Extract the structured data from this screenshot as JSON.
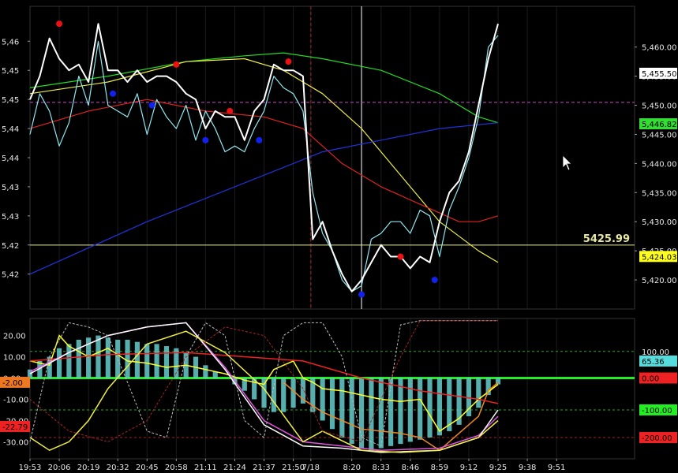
{
  "chart_data": [
    {
      "type": "line",
      "panel": "price",
      "y_axis_left": {
        "range": [
          5415,
          5467
        ],
        "ticks": [
          "5,46",
          "5,45",
          "5,45",
          "5,44",
          "5,44",
          "5,43",
          "5,43",
          "5,42",
          "5,42"
        ],
        "tick_values": [
          5461,
          5456,
          5451,
          5446,
          5441,
          5436,
          5431,
          5426,
          5421
        ]
      },
      "y_axis_right": {
        "range": [
          5415,
          5467
        ],
        "ticks": [
          "5,460.00",
          "5,455.00",
          "5,450.00",
          "5,445.00",
          "5,440.00",
          "5,435.00",
          "5,430.00",
          "5,425.00",
          "5,420.00"
        ],
        "tick_values": [
          5460,
          5455,
          5450,
          5445,
          5440,
          5435,
          5430,
          5425,
          5420
        ]
      },
      "x_axis": {
        "range": [
          0,
          62
        ],
        "ticks": [
          "19:53",
          "20:06",
          "20:19",
          "20:32",
          "20:45",
          "20:58",
          "21:11",
          "21:24",
          "21:37",
          "21:50",
          "7/18",
          "8:20",
          "8:33",
          "8:46",
          "8:59",
          "9:12",
          "9:25",
          "9:38",
          "9:51"
        ],
        "tick_positions": [
          0,
          3,
          6,
          9,
          12,
          15,
          18,
          21,
          24,
          27,
          28.8,
          33,
          36,
          39,
          42,
          45,
          48,
          51,
          54
        ]
      },
      "series": [
        {
          "color": "#ffffff",
          "x": [
            0,
            1,
            2,
            3,
            4,
            5,
            6,
            7,
            8,
            9,
            10,
            11,
            12,
            13,
            14,
            15,
            16,
            17,
            18,
            19,
            20,
            21,
            22,
            23,
            24,
            25,
            26,
            27,
            28,
            29,
            30,
            31,
            32,
            33,
            34,
            35,
            36,
            37,
            38,
            39,
            40,
            41,
            42,
            43,
            44,
            45,
            46,
            47,
            48
          ],
          "values": [
            5451,
            5455,
            5461.5,
            5458,
            5456,
            5457,
            5454,
            5464,
            5456,
            5456,
            5454,
            5456,
            5454,
            5455,
            5455,
            5454,
            5452,
            5451,
            5446,
            5449,
            5448,
            5448,
            5444,
            5449,
            5451,
            5457,
            5456,
            5456,
            5455,
            5427,
            5430,
            5425,
            5421,
            5418,
            5420,
            5423,
            5426,
            5424,
            5424,
            5422,
            5424,
            5423,
            5430,
            5435,
            5437,
            5442,
            5450,
            5458,
            5464
          ]
        },
        {
          "color": "#8fe8f0",
          "x": [
            0,
            1,
            2,
            3,
            4,
            5,
            6,
            7,
            8,
            9,
            10,
            11,
            12,
            13,
            14,
            15,
            16,
            17,
            18,
            19,
            20,
            21,
            22,
            23,
            24,
            25,
            26,
            27,
            28,
            29,
            30,
            31,
            32,
            33,
            34,
            35,
            36,
            37,
            38,
            39,
            40,
            41,
            42,
            43,
            44,
            45,
            46,
            47,
            48
          ],
          "values": [
            5445,
            5452,
            5449,
            5443,
            5447,
            5455,
            5450,
            5461,
            5450,
            5449,
            5448,
            5452,
            5445,
            5451,
            5448,
            5446,
            5450,
            5444,
            5449,
            5446,
            5442,
            5443,
            5442,
            5446,
            5449,
            5455,
            5453,
            5452,
            5449,
            5435,
            5428,
            5425,
            5420,
            5418,
            5419,
            5427,
            5428,
            5430,
            5430,
            5428,
            5432,
            5431,
            5424,
            5432,
            5436,
            5441,
            5448,
            5460,
            5462
          ]
        },
        {
          "color": "#22dd22",
          "x": [
            0,
            8,
            16,
            22,
            26,
            30,
            36,
            42,
            46,
            48
          ],
          "values": [
            5453,
            5455,
            5457.5,
            5458.5,
            5459,
            5458,
            5456,
            5452,
            5448,
            5447
          ]
        },
        {
          "color": "#eeee44",
          "x": [
            0,
            8,
            16,
            22,
            26,
            30,
            34,
            38,
            42,
            46,
            48
          ],
          "values": [
            5452,
            5454,
            5457.5,
            5458,
            5456,
            5452,
            5446,
            5438,
            5430,
            5425,
            5423
          ]
        },
        {
          "color": "#dd2222",
          "x": [
            0,
            6,
            12,
            18,
            24,
            28,
            32,
            36,
            40,
            44,
            46,
            48
          ],
          "values": [
            5446,
            5449,
            5451,
            5449,
            5448,
            5446,
            5440,
            5436,
            5433,
            5430,
            5430,
            5431
          ]
        },
        {
          "color": "#2233dd",
          "x": [
            0,
            12,
            24,
            30,
            36,
            42,
            48
          ],
          "values": [
            5421,
            5430,
            5438,
            5442,
            5444,
            5446,
            5447
          ]
        }
      ],
      "markers_red": [
        [
          3,
          5464
        ],
        [
          15,
          5457
        ],
        [
          20.5,
          5449
        ],
        [
          26.5,
          5457.5
        ],
        [
          38,
          5424
        ]
      ],
      "markers_blue": [
        [
          8.5,
          5452
        ],
        [
          12.5,
          5450
        ],
        [
          18,
          5444
        ],
        [
          23.5,
          5444
        ],
        [
          34,
          5417.5
        ],
        [
          41.5,
          5420
        ]
      ],
      "reference_lines": [
        {
          "value": 5425.99,
          "label": "5425.99",
          "color": "#e8e8a0"
        },
        {
          "value": 5450.5,
          "color": "#cc44cc",
          "dashed": true
        }
      ],
      "vertical_lines": [
        {
          "x": 28.8,
          "color": "#aa2222",
          "dashed": true
        },
        {
          "x": 34,
          "color": "#ffffff"
        }
      ],
      "right_tags": [
        {
          "value": 5455.5,
          "label": "5,455.50",
          "bg": "#ffffff",
          "fg": "#000000"
        },
        {
          "value": 5446.82,
          "label": "5,446.82",
          "bg": "#33dd33",
          "fg": "#000000"
        },
        {
          "value": 5424.03,
          "label": "5,424.03",
          "bg": "#ffff22",
          "fg": "#000000"
        }
      ]
    },
    {
      "type": "bar",
      "panel": "oscillator",
      "y_axis_left": {
        "range": [
          -38,
          28
        ],
        "ticks": [
          "20.00",
          "10.00",
          "0.00",
          "-10.00",
          "-20.00",
          "-30.00"
        ],
        "tick_values": [
          20,
          10,
          0,
          -10,
          -20,
          -30
        ]
      },
      "y_axis_right": {
        "ticks": [
          "100.00",
          "0.00",
          "-100.00",
          "-200.00"
        ],
        "tick_values": [
          12.5,
          0,
          -15,
          -28
        ]
      },
      "bars": {
        "color": "#66cccc",
        "x": [
          0,
          1,
          2,
          3,
          4,
          5,
          6,
          7,
          8,
          9,
          10,
          11,
          12,
          13,
          14,
          15,
          16,
          17,
          18,
          19,
          20,
          21,
          22,
          23,
          24,
          25,
          26,
          27,
          28,
          29,
          30,
          31,
          32,
          33,
          34,
          35,
          36,
          37,
          38,
          39,
          40,
          41,
          42,
          43,
          44,
          45,
          46,
          47,
          48
        ],
        "values": [
          4,
          8,
          10,
          14,
          16,
          18,
          19,
          20,
          19,
          18,
          18,
          17,
          16,
          16,
          15,
          14,
          12,
          10,
          6,
          3,
          0,
          -3,
          -6,
          -10,
          -14,
          -16,
          -16,
          -14,
          -12,
          -16,
          -20,
          -24,
          -28,
          -31,
          -33,
          -34,
          -33,
          -32,
          -31,
          -30,
          -29,
          -28,
          -27,
          -25,
          -22,
          -18,
          -14,
          -8,
          -3
        ]
      },
      "series": [
        {
          "color": "#ffff22",
          "x": [
            0,
            2,
            3,
            4,
            6,
            8,
            10,
            12,
            14,
            16,
            18,
            20,
            22,
            24,
            25,
            26,
            27,
            28,
            29,
            30,
            32,
            34,
            36,
            38,
            40,
            42,
            44,
            46,
            48
          ],
          "values": [
            8,
            6,
            20,
            15,
            10,
            14,
            8,
            7,
            5,
            6,
            4,
            2,
            -1,
            -3,
            4,
            6,
            8,
            0,
            -2,
            -5,
            -6,
            -8,
            -10,
            -11,
            -10,
            -25,
            -19,
            -10,
            -3
          ]
        },
        {
          "color": "#ee8822",
          "x": [
            26,
            28,
            30,
            32,
            34,
            36,
            38,
            40,
            42,
            44,
            46,
            47,
            48
          ],
          "values": [
            -2,
            -10,
            -16,
            -20,
            -24,
            -25,
            -26,
            -28,
            -34,
            -26,
            -18,
            -6,
            -2
          ]
        },
        {
          "color": "#ee2222",
          "x": [
            0,
            8,
            16,
            22,
            28,
            34,
            40,
            46,
            48
          ],
          "values": [
            8,
            11,
            12,
            10,
            8,
            0,
            -6,
            -10,
            -12
          ]
        },
        {
          "color": "#dd55dd",
          "x": [
            0,
            4,
            8,
            12,
            16,
            20,
            24,
            28,
            32,
            36,
            42,
            46,
            48
          ],
          "values": [
            3,
            12,
            20,
            24,
            26,
            5,
            -20,
            -30,
            -32,
            -34,
            -33,
            -27,
            -18
          ]
        },
        {
          "color": "#ffffff",
          "x": [
            0,
            4,
            8,
            12,
            16,
            20,
            24,
            28,
            32,
            36,
            42,
            46,
            48
          ],
          "values": [
            2,
            12,
            20,
            24,
            26,
            4,
            -22,
            -32,
            -33,
            -35,
            -34,
            -28,
            -15
          ]
        },
        {
          "color": "#eeee44",
          "x": [
            0,
            2,
            4,
            6,
            8,
            12,
            16,
            20,
            24,
            28,
            30,
            34,
            38,
            42,
            46,
            48
          ],
          "values": [
            -28,
            -34,
            -30,
            -20,
            -5,
            16,
            22,
            12,
            -5,
            -30,
            -25,
            -34,
            -35,
            -34,
            -28,
            -20
          ]
        },
        {
          "color": "#bbbbbb",
          "dashed": true,
          "x": [
            0,
            2,
            4,
            6,
            8,
            10,
            12,
            14,
            16,
            18,
            20,
            22,
            24,
            26,
            28,
            30,
            32,
            34,
            36,
            38,
            40,
            42,
            44,
            46,
            48
          ],
          "values": [
            -30,
            10,
            26,
            24,
            20,
            -2,
            -25,
            -28,
            10,
            26,
            20,
            -20,
            -28,
            20,
            26,
            26,
            10,
            -28,
            -32,
            25,
            27,
            27,
            27,
            27,
            27
          ]
        },
        {
          "color": "#aa2222",
          "dashed": true,
          "x": [
            0,
            4,
            8,
            12,
            16,
            20,
            24,
            28,
            30,
            34,
            38,
            40,
            42,
            44,
            48
          ],
          "values": [
            -10,
            -25,
            -30,
            -20,
            10,
            24,
            20,
            -5,
            -25,
            -30,
            10,
            27,
            27,
            27,
            27
          ]
        }
      ],
      "reference_lines": [
        {
          "value": 0,
          "color": "#22ee22",
          "width": 3
        },
        {
          "value": 12.5,
          "color": "#22aa22",
          "dashed": true
        },
        {
          "value": -15,
          "color": "#22aa22",
          "dashed": true
        },
        {
          "value": -28,
          "color": "#aa2222",
          "dashed": true
        }
      ],
      "left_tags": [
        {
          "value": -2,
          "label": "-2.00",
          "bg": "#ee7722",
          "fg": "#000000"
        },
        {
          "value": -22.79,
          "label": "-22.79",
          "bg": "#ee2222",
          "fg": "#000000"
        }
      ],
      "right_tags": [
        {
          "value": 8,
          "label": "65.36",
          "bg": "#55dddd",
          "fg": "#000000"
        },
        {
          "value": 0,
          "label": "0.00",
          "bg": "#ee2222",
          "fg": "#000000"
        },
        {
          "value": -15,
          "label": "-100.00",
          "bg": "#22ee22",
          "fg": "#000000"
        },
        {
          "value": -28,
          "label": "-200.00",
          "bg": "#ee2222",
          "fg": "#000000"
        }
      ]
    }
  ]
}
